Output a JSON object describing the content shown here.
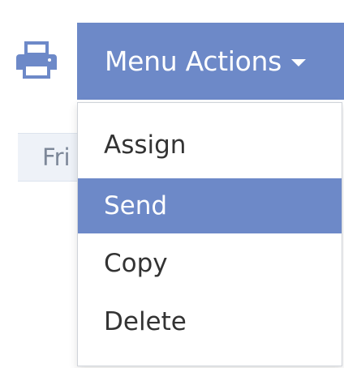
{
  "toolbar": {
    "print_icon": "printer-icon",
    "menu_button_label": "Menu Actions",
    "caret_icon": "caret-down-icon"
  },
  "background": {
    "row_label": "Fri"
  },
  "menu": {
    "items": [
      {
        "label": "Assign",
        "active": false
      },
      {
        "label": "Send",
        "active": true
      },
      {
        "label": "Copy",
        "active": false
      },
      {
        "label": "Delete",
        "active": false
      }
    ]
  },
  "colors": {
    "accent": "#6d89c8",
    "menu_text": "#333333",
    "muted_text": "#7d8899"
  }
}
